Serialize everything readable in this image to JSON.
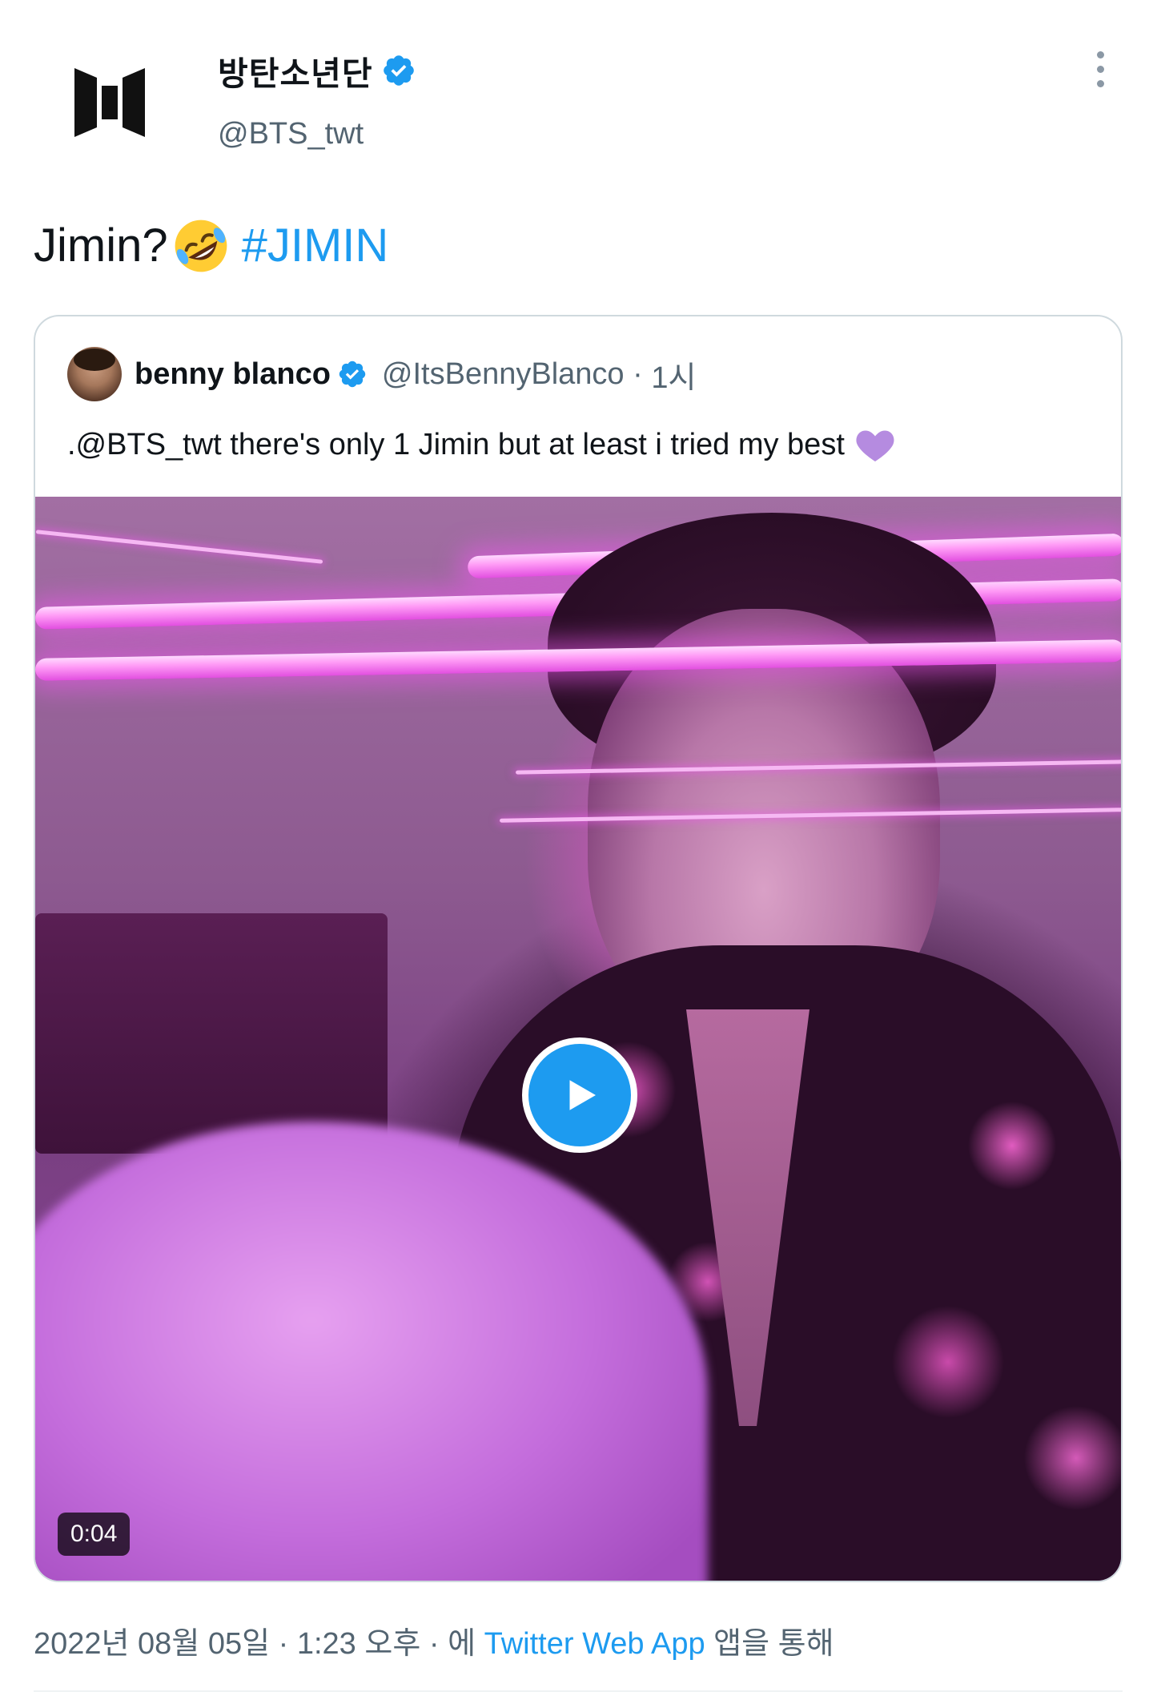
{
  "tweet": {
    "author": {
      "display_name": "방탄소년단",
      "handle": "@BTS_twt",
      "verified": true
    },
    "text": "Jimin?",
    "emoji": "rolling-on-floor-laughing",
    "hashtag": "#JIMIN",
    "quoted": {
      "display_name": "benny blanco",
      "handle": "@ItsBennyBlanco",
      "separator": "·",
      "time": "1시",
      "text": ".@BTS_twt there's only 1 Jimin but at least i tried my best",
      "emoji": "purple-heart",
      "media": {
        "type": "video",
        "duration": "0:04"
      }
    },
    "footer": {
      "date": "2022년 08월 05일",
      "sep1": " · ",
      "time": "1:23 오후",
      "sep2": " · ",
      "prefix": "에 ",
      "app": "Twitter Web App",
      "suffix": " 앱을 통해"
    }
  },
  "colors": {
    "accent": "#1d9bf0",
    "secondary_text": "#536471",
    "border": "#cfd9de"
  }
}
